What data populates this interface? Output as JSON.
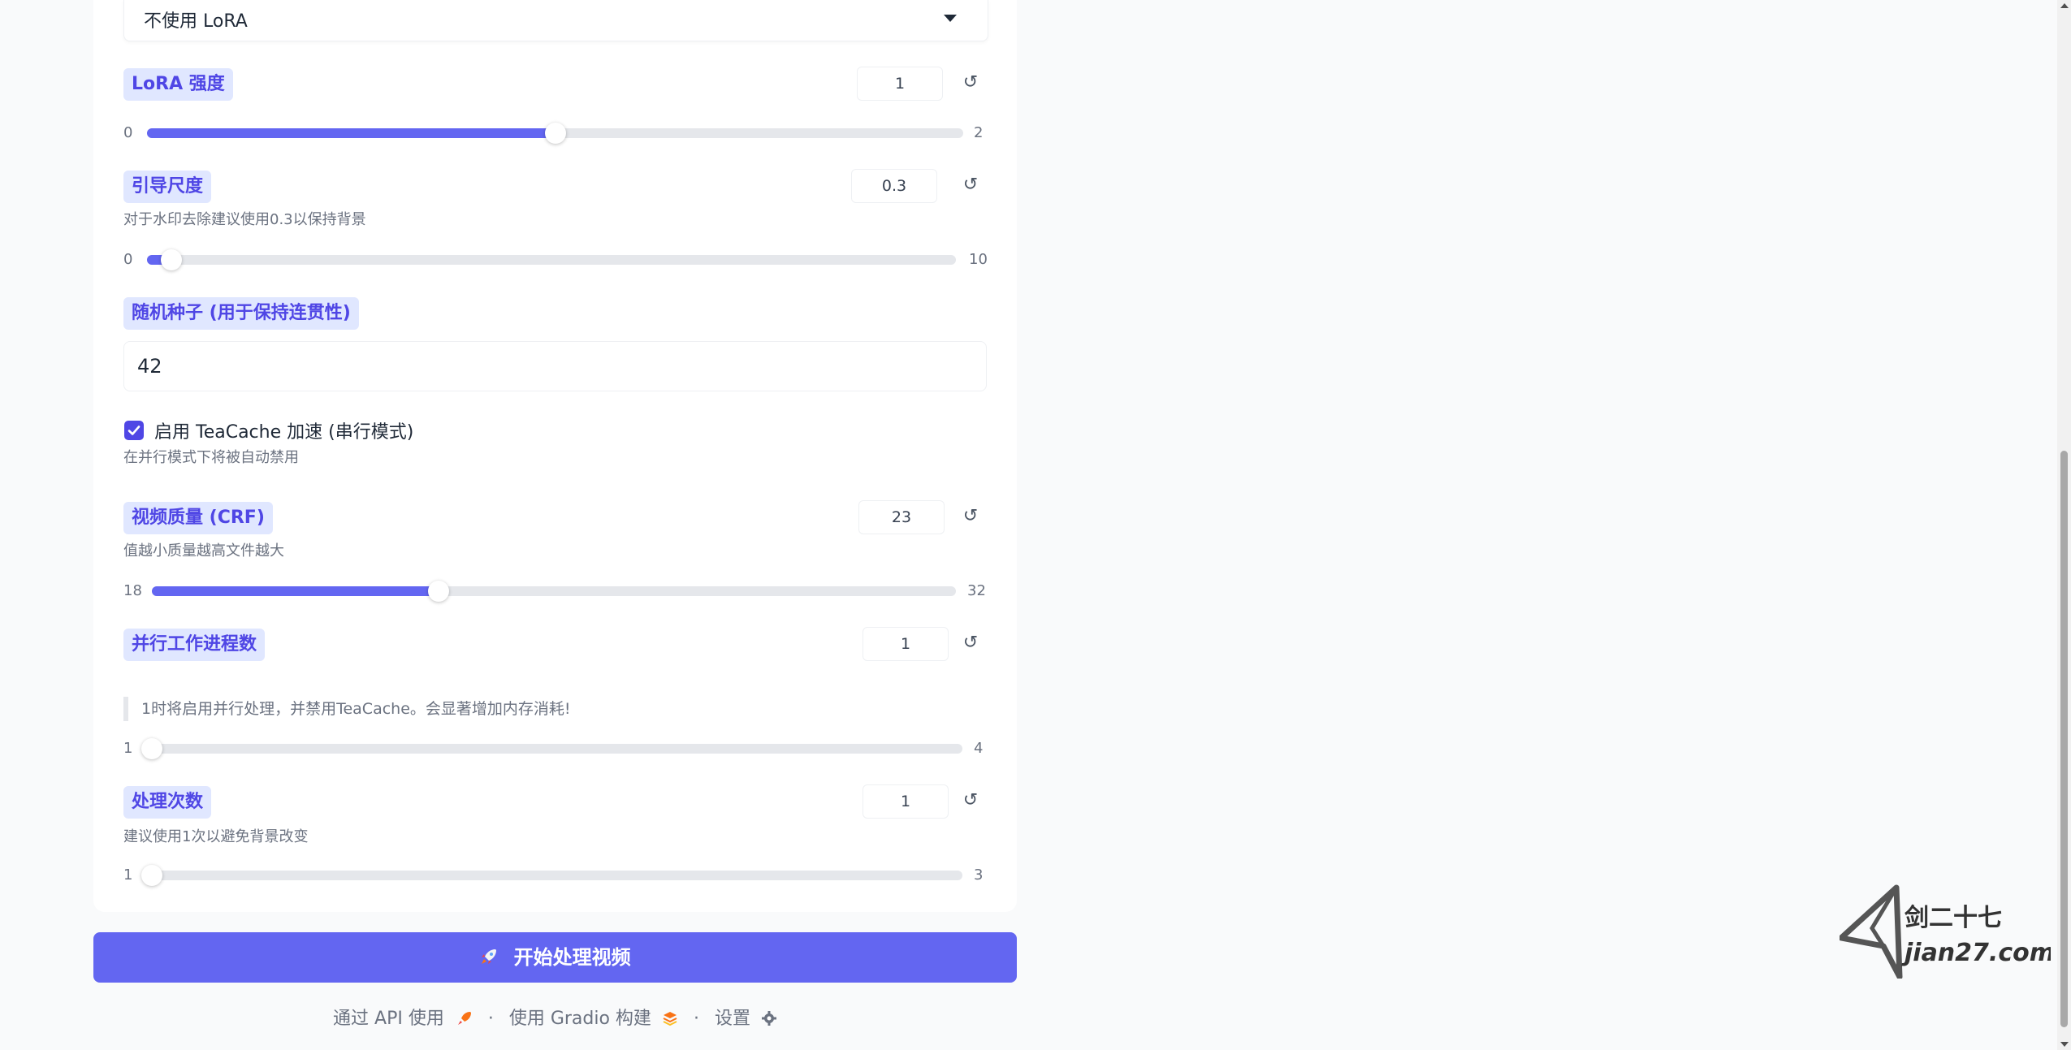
{
  "lora_select": {
    "value": "不使用 LoRA"
  },
  "lora_strength": {
    "label": "LoRA 强度",
    "value": "1",
    "min": "0",
    "max": "2",
    "fraction": 0.5
  },
  "guidance_scale": {
    "label": "引导尺度",
    "info": "对于水印去除建议使用0.3以保持背景",
    "value": "0.3",
    "min": "0",
    "max": "10",
    "fraction": 0.03
  },
  "seed": {
    "label": "随机种子 (用于保持连贯性)",
    "value": "42"
  },
  "teacache": {
    "label": "启用 TeaCache 加速 (串行模式)",
    "info": "在并行模式下将被自动禁用",
    "checked": true
  },
  "crf": {
    "label": "视频质量 (CRF)",
    "info": "值越小质量越高文件越大",
    "value": "23",
    "min": "18",
    "max": "32",
    "fraction": 0.357
  },
  "workers": {
    "label": "并行工作进程数",
    "note": "1时将启用并行处理，并禁用TeaCache。会显著增加内存消耗!",
    "value": "1",
    "min": "1",
    "max": "4",
    "fraction": 0.0
  },
  "passes": {
    "label": "处理次数",
    "info": "建议使用1次以避免背景改变",
    "value": "1",
    "min": "1",
    "max": "3",
    "fraction": 0.0
  },
  "submit": {
    "label": "开始处理视频",
    "icon": "rocket-icon"
  },
  "footer": {
    "api": "通过 API 使用",
    "built": "使用 Gradio 构建",
    "settings": "设置",
    "sep": "·"
  },
  "watermark": {
    "text_cn": "剑二十七",
    "text_url": "jian27.com"
  },
  "reset_symbol": "↺",
  "colors": {
    "accent": "#6366f1",
    "badge_bg": "#e0e7ff",
    "badge_text": "#4f46e5",
    "track": "#e5e7eb"
  }
}
